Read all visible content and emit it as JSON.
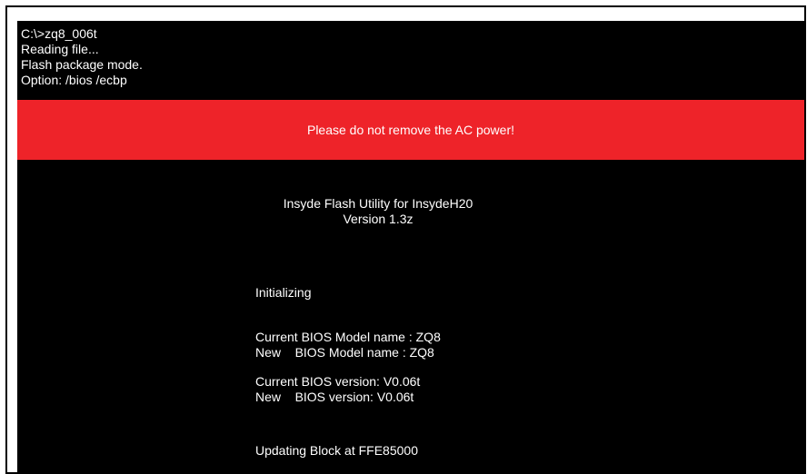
{
  "console": {
    "lines": [
      "C:\\>zq8_006t",
      "Reading file...",
      "Flash package mode.",
      "Option: /bios /ecbp"
    ]
  },
  "warning": {
    "text": "Please do not remove the AC power!",
    "color": "#ee2329"
  },
  "utility": {
    "title": "Insyde Flash Utility for InsydeH20",
    "version": "Version 1.3z"
  },
  "status": {
    "initializing": "Initializing",
    "current_model": "Current BIOS Model name : ZQ8",
    "new_model": "New    BIOS Model name : ZQ8",
    "current_version": "Current BIOS version: V0.06t",
    "new_version": "New    BIOS version: V0.06t",
    "updating": "Updating Block at FFE85000"
  },
  "colors": {
    "background": "#000000",
    "text": "#ffffff",
    "frame": "#000000"
  }
}
